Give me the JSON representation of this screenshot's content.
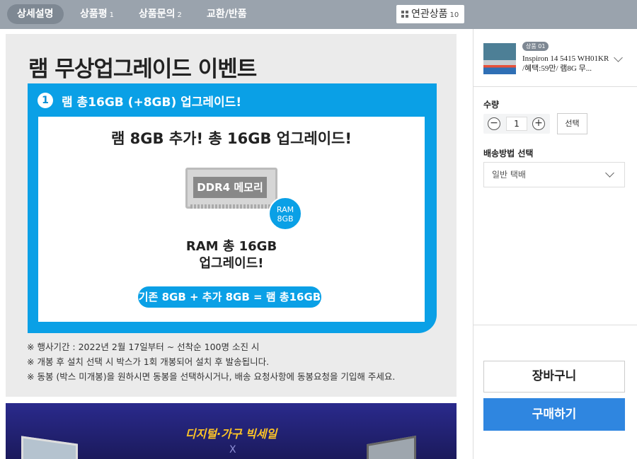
{
  "tabs": [
    {
      "label": "상세설명",
      "count": ""
    },
    {
      "label": "상품평",
      "count": "1"
    },
    {
      "label": "상품문의",
      "count": "2"
    },
    {
      "label": "교환/반품",
      "count": ""
    }
  ],
  "related": {
    "label": "연관상품",
    "count": "10"
  },
  "event": {
    "title": "램 무상업그레이드 이벤트",
    "step_number": "1",
    "step_heading": "램 총16GB (+8GB) 업그레이드!",
    "panel_title": "램 8GB 추가!  총 16GB 업그레이드!",
    "memory_label": "DDR4 메모리",
    "ram_badge_line1": "RAM",
    "ram_badge_line2": "8GB",
    "total_line1": "RAM 총 16GB",
    "total_line2": "업그레이드!",
    "formula": "기존 8GB + 추가 8GB = 램 총16GB",
    "notes": [
      "※ 행사기간 : 2022년 2월 17일부터 ~ 선착순 100명 소진 시",
      "※ 개봉 후 설치 선택 시 박스가 1회 개봉되어 설치 후 발송됩니다.",
      "※ 동봉 (박스 미개봉)을 원하시면 동봉을 선택하시거나, 배송 요청사항에 동봉요청을 기입해 주세요."
    ]
  },
  "banner2": {
    "title": "디지털·가구 빅세일",
    "x_mark": "X"
  },
  "product": {
    "badge": "상품 01",
    "name": "Inspiron 14 5415 WH01KR /혜택:59만/ 램8G 무..."
  },
  "quantity": {
    "label": "수량",
    "value": "1",
    "minus": "−",
    "plus": "+",
    "select_label": "선택"
  },
  "shipping": {
    "label": "배송방법 선택",
    "value": "일반 택배"
  },
  "actions": {
    "cart": "장바구니",
    "buy": "구매하기"
  },
  "colors": {
    "accent_blue": "#0aa0e6",
    "buy_button": "#2f86e0",
    "topbar": "#9aa3ad"
  }
}
